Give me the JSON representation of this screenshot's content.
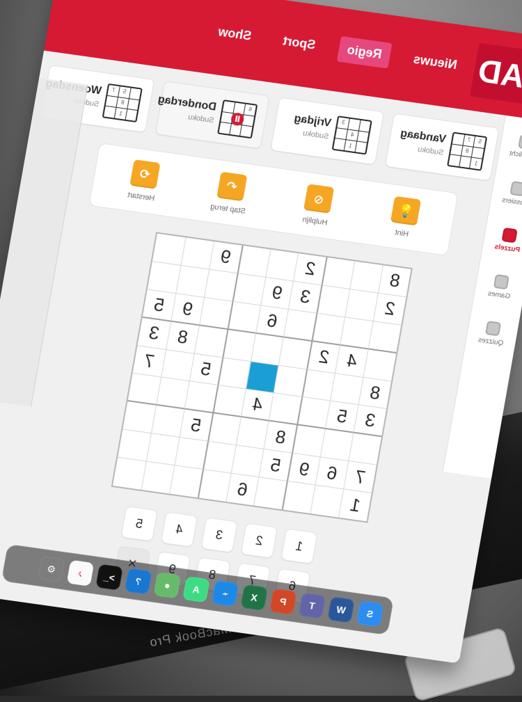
{
  "brand": {
    "logo_text": "AD"
  },
  "nav": {
    "items": [
      {
        "label": "Nieuws",
        "active": false
      },
      {
        "label": "Regio",
        "active": true
      },
      {
        "label": "Sport",
        "active": false
      },
      {
        "label": "Show",
        "active": false
      }
    ]
  },
  "rail": {
    "items": [
      {
        "label": "Uitgelicht",
        "icon": "star-icon",
        "active": false
      },
      {
        "label": "Dossiers",
        "icon": "clock-icon",
        "active": false
      },
      {
        "label": "Puzzels",
        "icon": "puzzle-icon",
        "active": true
      },
      {
        "label": "Games",
        "icon": "gamepad-icon",
        "active": false
      },
      {
        "label": "Quizzes",
        "icon": "quiz-icon",
        "active": false
      }
    ]
  },
  "days": [
    {
      "label": "Vandaag",
      "sub": "Sudoku",
      "selected": false,
      "mini": [
        "5",
        "7",
        "",
        "",
        "8",
        "",
        "1",
        "",
        ""
      ],
      "paused": false
    },
    {
      "label": "Vrijdag",
      "sub": "Sudoku",
      "selected": false,
      "mini": [
        "",
        "",
        "3",
        "",
        "4",
        "",
        "",
        "1",
        ""
      ],
      "paused": false
    },
    {
      "label": "Donderdag",
      "sub": "Sudoku",
      "selected": true,
      "mini": [
        "6",
        "",
        "",
        "",
        "",
        "",
        "",
        "",
        ""
      ],
      "paused": true
    },
    {
      "label": "Woensdag",
      "sub": "Sudoku",
      "selected": false,
      "mini": [
        "",
        "5",
        "7",
        "",
        "8",
        "",
        "",
        "1",
        ""
      ],
      "paused": false
    }
  ],
  "tools": [
    {
      "label": "Hint",
      "icon": "bulb-icon"
    },
    {
      "label": "Hulplijn",
      "icon": "eye-slash-icon"
    },
    {
      "label": "Stap terug",
      "icon": "undo-icon"
    },
    {
      "label": "Herstart",
      "icon": "restart-icon"
    }
  ],
  "board": {
    "cells": [
      [
        "8",
        "",
        "",
        "2",
        "",
        "",
        "9",
        "",
        ""
      ],
      [
        "2",
        "",
        "",
        "3",
        "9",
        "",
        "",
        "",
        ""
      ],
      [
        "",
        "",
        "",
        "",
        "6",
        "",
        "",
        "9",
        "5"
      ],
      [
        "",
        "4",
        "2",
        "",
        "",
        "",
        "",
        "8",
        "3"
      ],
      [
        "8",
        "",
        "",
        "",
        "",
        "",
        "5",
        "",
        "7"
      ],
      [
        "3",
        "5",
        "",
        "",
        "4",
        "",
        "",
        "",
        ""
      ],
      [
        "",
        "",
        "",
        "8",
        "",
        "",
        "5",
        "",
        ""
      ],
      [
        "7",
        "6",
        "9",
        "5",
        "",
        "",
        "",
        "",
        ""
      ],
      [
        "1",
        "",
        "",
        "",
        "6",
        "",
        "",
        "",
        ""
      ]
    ],
    "selected": {
      "row": 4,
      "col": 4
    }
  },
  "numpad": {
    "row1": [
      "1",
      "2",
      "3",
      "4",
      "5"
    ],
    "row2": [
      "6",
      "7",
      "8",
      "9",
      "×"
    ]
  },
  "device": {
    "label": "MacBook Pro"
  },
  "dock": {
    "icons": [
      {
        "name": "safari-icon",
        "text": "S",
        "color": "#2d8cf0"
      },
      {
        "name": "word-icon",
        "text": "W",
        "color": "#2b579a"
      },
      {
        "name": "teams-icon",
        "text": "T",
        "color": "#6264a7"
      },
      {
        "name": "powerpoint-icon",
        "text": "P",
        "color": "#d24726"
      },
      {
        "name": "excel-icon",
        "text": "X",
        "color": "#217346"
      },
      {
        "name": "xcode-icon",
        "text": "⌁",
        "color": "#1e88e5"
      },
      {
        "name": "android-icon",
        "text": "A",
        "color": "#3ddc84"
      },
      {
        "name": "globe-icon",
        "text": "●",
        "color": "#66bb6a"
      },
      {
        "name": "help-icon",
        "text": "?",
        "color": "#1976d2"
      },
      {
        "name": "terminal-icon",
        "text": ">_",
        "color": "#111111"
      },
      {
        "name": "music-icon",
        "text": "♪",
        "color": "#fafafa"
      },
      {
        "name": "settings-icon",
        "text": "⚙",
        "color": "#7d7d7d"
      }
    ]
  }
}
